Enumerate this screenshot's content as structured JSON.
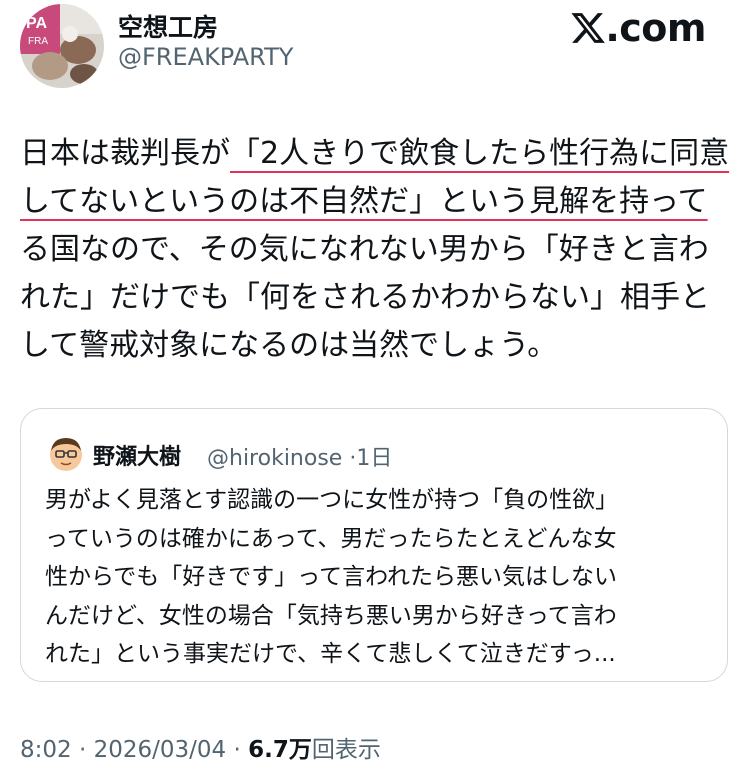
{
  "author": {
    "display_name": "空想工房",
    "handle": "@FREAKPARTY"
  },
  "brand": {
    "label": ".com"
  },
  "tweet": {
    "lines": [
      {
        "before": "日本は裁判長が",
        "highlight": "「2人きりで飲食したら性行為に同意",
        "after": ""
      },
      {
        "before": "",
        "highlight": "してないというのは不自然だ」という見解を持って",
        "after": ""
      },
      {
        "before": "る国なので、その気になれない男から「好きと言わ",
        "highlight": "",
        "after": ""
      },
      {
        "before": "れた」だけでも「何をされるかわからない」相手と",
        "highlight": "",
        "after": ""
      },
      {
        "before": "して警戒対象になるのは当然でしょう。",
        "highlight": "",
        "after": ""
      }
    ]
  },
  "quote": {
    "name": "野瀬大樹",
    "handle": "@hirokinose",
    "separator": "·",
    "time": "1日",
    "lines": [
      "男がよく見落とす認識の一つに女性が持つ「負の性欲」",
      "っていうのは確かにあって、男だったらたとえどんな女",
      "性からでも「好きです」って言われたら悪い気はしない",
      "んだけど、女性の場合「気持ち悪い男から好きって言わ",
      "れた」という事実だけで、辛くて悲しくて泣きだすっ..."
    ]
  },
  "footer": {
    "time": "8:02",
    "separator": "·",
    "date": "2026/03/04",
    "views_count": "6.7万",
    "views_label": "回表示"
  },
  "colors": {
    "text": "#0f1419",
    "secondary": "#536471",
    "underline": "#e0345a",
    "border": "#cfd9de"
  }
}
